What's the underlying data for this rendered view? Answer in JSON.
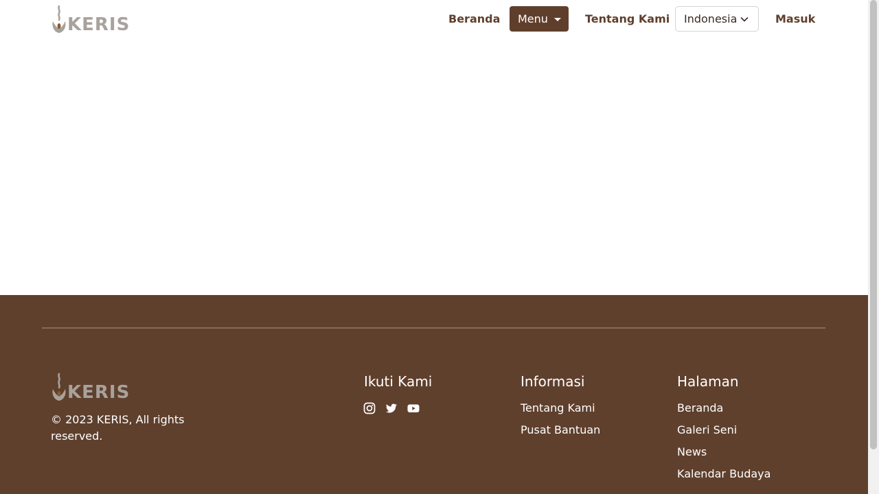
{
  "header": {
    "logo_text": "KERIS",
    "nav": {
      "beranda": "Beranda",
      "menu": "Menu",
      "tentang": "Tentang Kami",
      "language": "Indonesia",
      "masuk": "Masuk"
    }
  },
  "footer": {
    "logo_text": "KERIS",
    "copyright": "© 2023 KERIS, All rights reserved.",
    "follow": {
      "title": "Ikuti Kami",
      "icons": [
        "instagram-icon",
        "twitter-icon",
        "youtube-icon"
      ]
    },
    "informasi": {
      "title": "Informasi",
      "links": [
        "Tentang Kami",
        "Pusat Bantuan"
      ]
    },
    "halaman": {
      "title": "Halaman",
      "links": [
        "Beranda",
        "Galeri Seni",
        "News",
        "Kalendar Budaya"
      ]
    }
  },
  "colors": {
    "brand_brown": "#5f402d",
    "logo_grey": "#a8a29c",
    "white": "#ffffff"
  }
}
